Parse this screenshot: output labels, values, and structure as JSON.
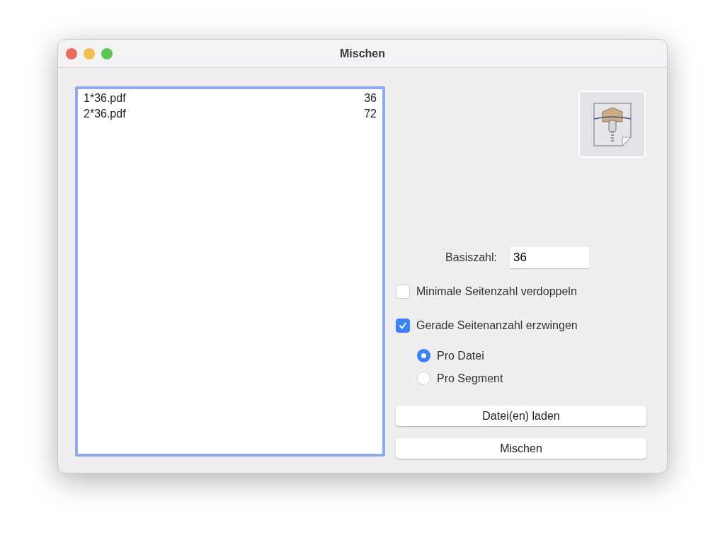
{
  "window": {
    "title": "Mischen"
  },
  "file_list": {
    "rows": [
      {
        "name": "1*36.pdf",
        "pages": "36"
      },
      {
        "name": "2*36.pdf",
        "pages": "72"
      }
    ]
  },
  "basiszahl": {
    "label": "Basiszahl:",
    "value": "36"
  },
  "checkboxes": [
    {
      "label": "Minimale Seitenzahl verdoppeln",
      "checked": false
    },
    {
      "label": "Gerade Seitenanzahl erzwingen",
      "checked": true
    }
  ],
  "radios": [
    {
      "label": "Pro Datei",
      "selected": true
    },
    {
      "label": "Pro Segment",
      "selected": false
    }
  ],
  "buttons": [
    "Datei(en) laden",
    "Mischen"
  ]
}
